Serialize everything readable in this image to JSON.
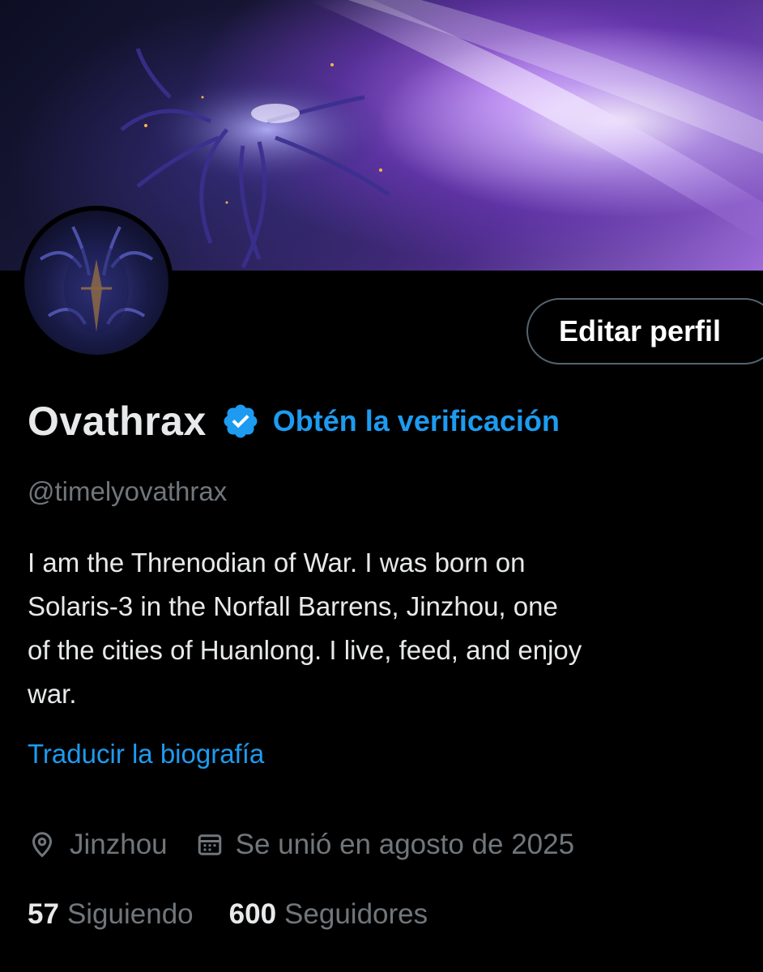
{
  "profile": {
    "display_name": "Ovathrax",
    "verified_icon": "verified-badge-icon",
    "get_verified_label": "Obtén la verificación",
    "handle": "@timelyovathrax",
    "bio": "I am the Threnodian of War. I was born on\nSolaris-3 in the Norfall Barrens, Jinzhou, one\nof the cities of Huanlong. I live, feed, and enjoy\nwar.",
    "translate_bio_label": "Traducir la biografía",
    "location": "Jinzhou",
    "joined": "Se unió en agosto de 2025",
    "following_count": "57",
    "following_label": "Siguiendo",
    "followers_count": "600",
    "followers_label": "Seguidores"
  },
  "actions": {
    "edit_profile_label": "Editar perfil"
  },
  "colors": {
    "background": "#000000",
    "primary_text": "#e7e9ea",
    "secondary_text": "#71767b",
    "accent_blue": "#1d9bf0",
    "button_border": "#536471"
  },
  "icons": {
    "location": "location-pin-icon",
    "calendar": "calendar-icon"
  }
}
